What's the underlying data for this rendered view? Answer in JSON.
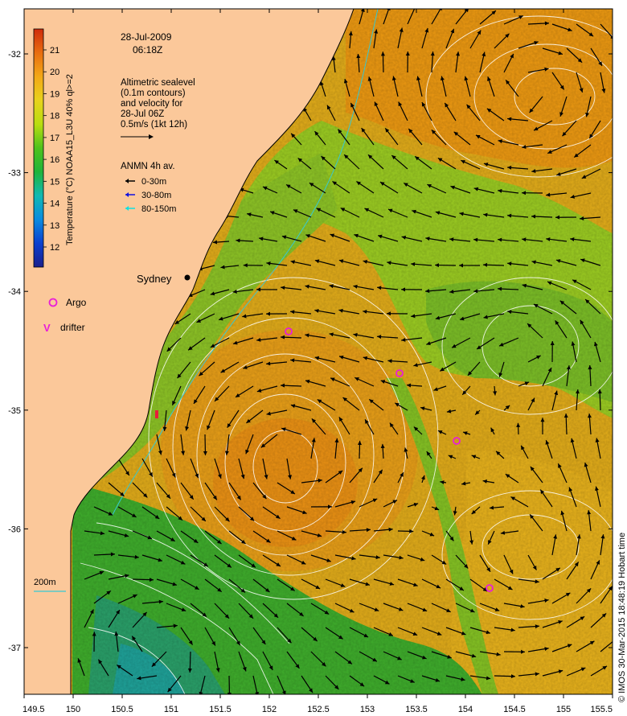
{
  "header": {
    "date": "28-Jul-2009",
    "time": "06:18Z"
  },
  "colorbar": {
    "title": "Temperature (°C) NOAA15_L3U 40% ql>=2",
    "ticks": [
      "12",
      "13",
      "14",
      "15",
      "16",
      "17",
      "18",
      "19",
      "20",
      "21"
    ],
    "colors": [
      "#1a1f8c",
      "#0b3fcf",
      "#0a8be0",
      "#12b9b2",
      "#1fb43a",
      "#4ec21b",
      "#b9dd10",
      "#e8d21c",
      "#f3a817",
      "#e86d10",
      "#cf2b0a"
    ]
  },
  "altimetry_note": {
    "lines": [
      "Altimetric sealevel",
      "(0.1m contours)",
      "and velocity for",
      "28-Jul 06Z",
      "0.5m/s (1kt 12h)"
    ]
  },
  "anmn_legend": {
    "title": "ANMN 4h av.",
    "items": [
      {
        "label": "0-30m",
        "color": "#000000"
      },
      {
        "label": "30-80m",
        "color": "#1010e0"
      },
      {
        "label": "80-150m",
        "color": "#10e0e0"
      }
    ]
  },
  "argo_legend": {
    "label": "Argo",
    "color": "#e81ed8"
  },
  "drifter_legend": {
    "symbol": "V",
    "label": "drifter",
    "color": "#e81ed8"
  },
  "city": {
    "name": "Sydney"
  },
  "isobath_label": "200m",
  "credit": "© IMOS 30-Mar-2015 18:48:19 Hobart time",
  "axes": {
    "x_ticks": [
      "149.5",
      "150",
      "150.5",
      "151",
      "151.5",
      "152",
      "152.5",
      "153",
      "153.5",
      "154",
      "154.5",
      "155",
      "155.5"
    ],
    "y_ticks": [
      "-32",
      "-33",
      "-34",
      "-35",
      "-36",
      "-37"
    ]
  },
  "colors": {
    "land": "#fbc89a",
    "coast": "#000000",
    "contour": "#ffffff",
    "argo": "#e81ed8"
  }
}
